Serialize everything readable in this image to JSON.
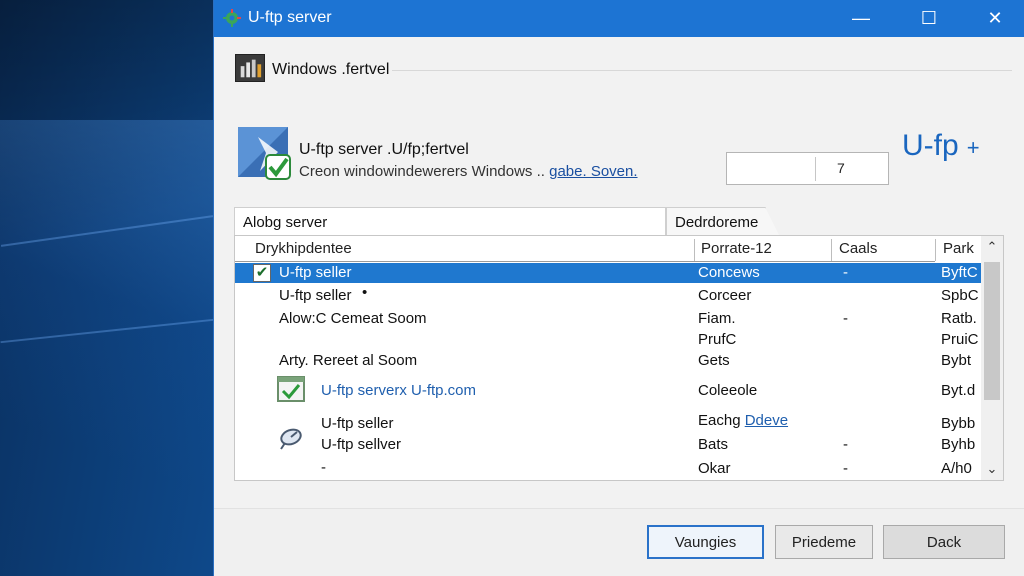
{
  "window": {
    "title": "U-ftp server",
    "controls": {
      "minimize": "—",
      "maximize": "☐",
      "close": "✕"
    }
  },
  "location": {
    "label": "Windows .fertvel"
  },
  "app": {
    "name": "U-ftp server .U/fp;fertvel",
    "description_prefix": "Creon windowindewerers Windows .. ",
    "description_link": "gabe. Soven.",
    "field_value": "7",
    "brand": "U-fp",
    "brand_plus": "+"
  },
  "tabs": [
    {
      "label": "Alobg server"
    },
    {
      "label": "Dedrdoreme"
    }
  ],
  "list": {
    "headers": [
      "Drykhipdentee",
      "Porrate-12",
      "Caals",
      "Park"
    ],
    "rows": [
      {
        "c1": "U-ftp seller",
        "c2": "Concews",
        "c3": "-",
        "c4": "ByftC",
        "selected": true,
        "checked": true
      },
      {
        "c1": "U-ftp seller",
        "c2": "Corceer",
        "c3": "",
        "c4": "SpbC"
      },
      {
        "c1": "Alow:C Cemeat Soom",
        "c2": "Fiam.",
        "c3": "-",
        "c4": "Ratb."
      },
      {
        "c1": "",
        "c2": "PrufC",
        "c3": "",
        "c4": "PruiC"
      },
      {
        "c1": "Arty. Rereet al Soom",
        "c2": "Gets",
        "c3": "",
        "c4": "Bybt"
      },
      {
        "c1": "U-ftp serverx U-ftp.com",
        "c2": "Coleeole",
        "c3": "",
        "c4": "Byt.d"
      },
      {
        "c1": "U-ftp seller",
        "c2": "Eachg ",
        "c2_link": "Ddeve",
        "c3": "",
        "c4": "Bybb"
      },
      {
        "c1": "U-ftp sellver",
        "c2": "Bats",
        "c3": "-",
        "c4": "Byhb"
      },
      {
        "c1": "-",
        "c2": "Okar",
        "c3": "-",
        "c4": "A/h0"
      }
    ]
  },
  "buttons": {
    "primary": "Vaungies",
    "secondary": "Priedeme",
    "tertiary": "Dack"
  },
  "colors": {
    "titlebar": "#1d74d3",
    "selection": "#1f78cf",
    "brand": "#1a66bf"
  }
}
